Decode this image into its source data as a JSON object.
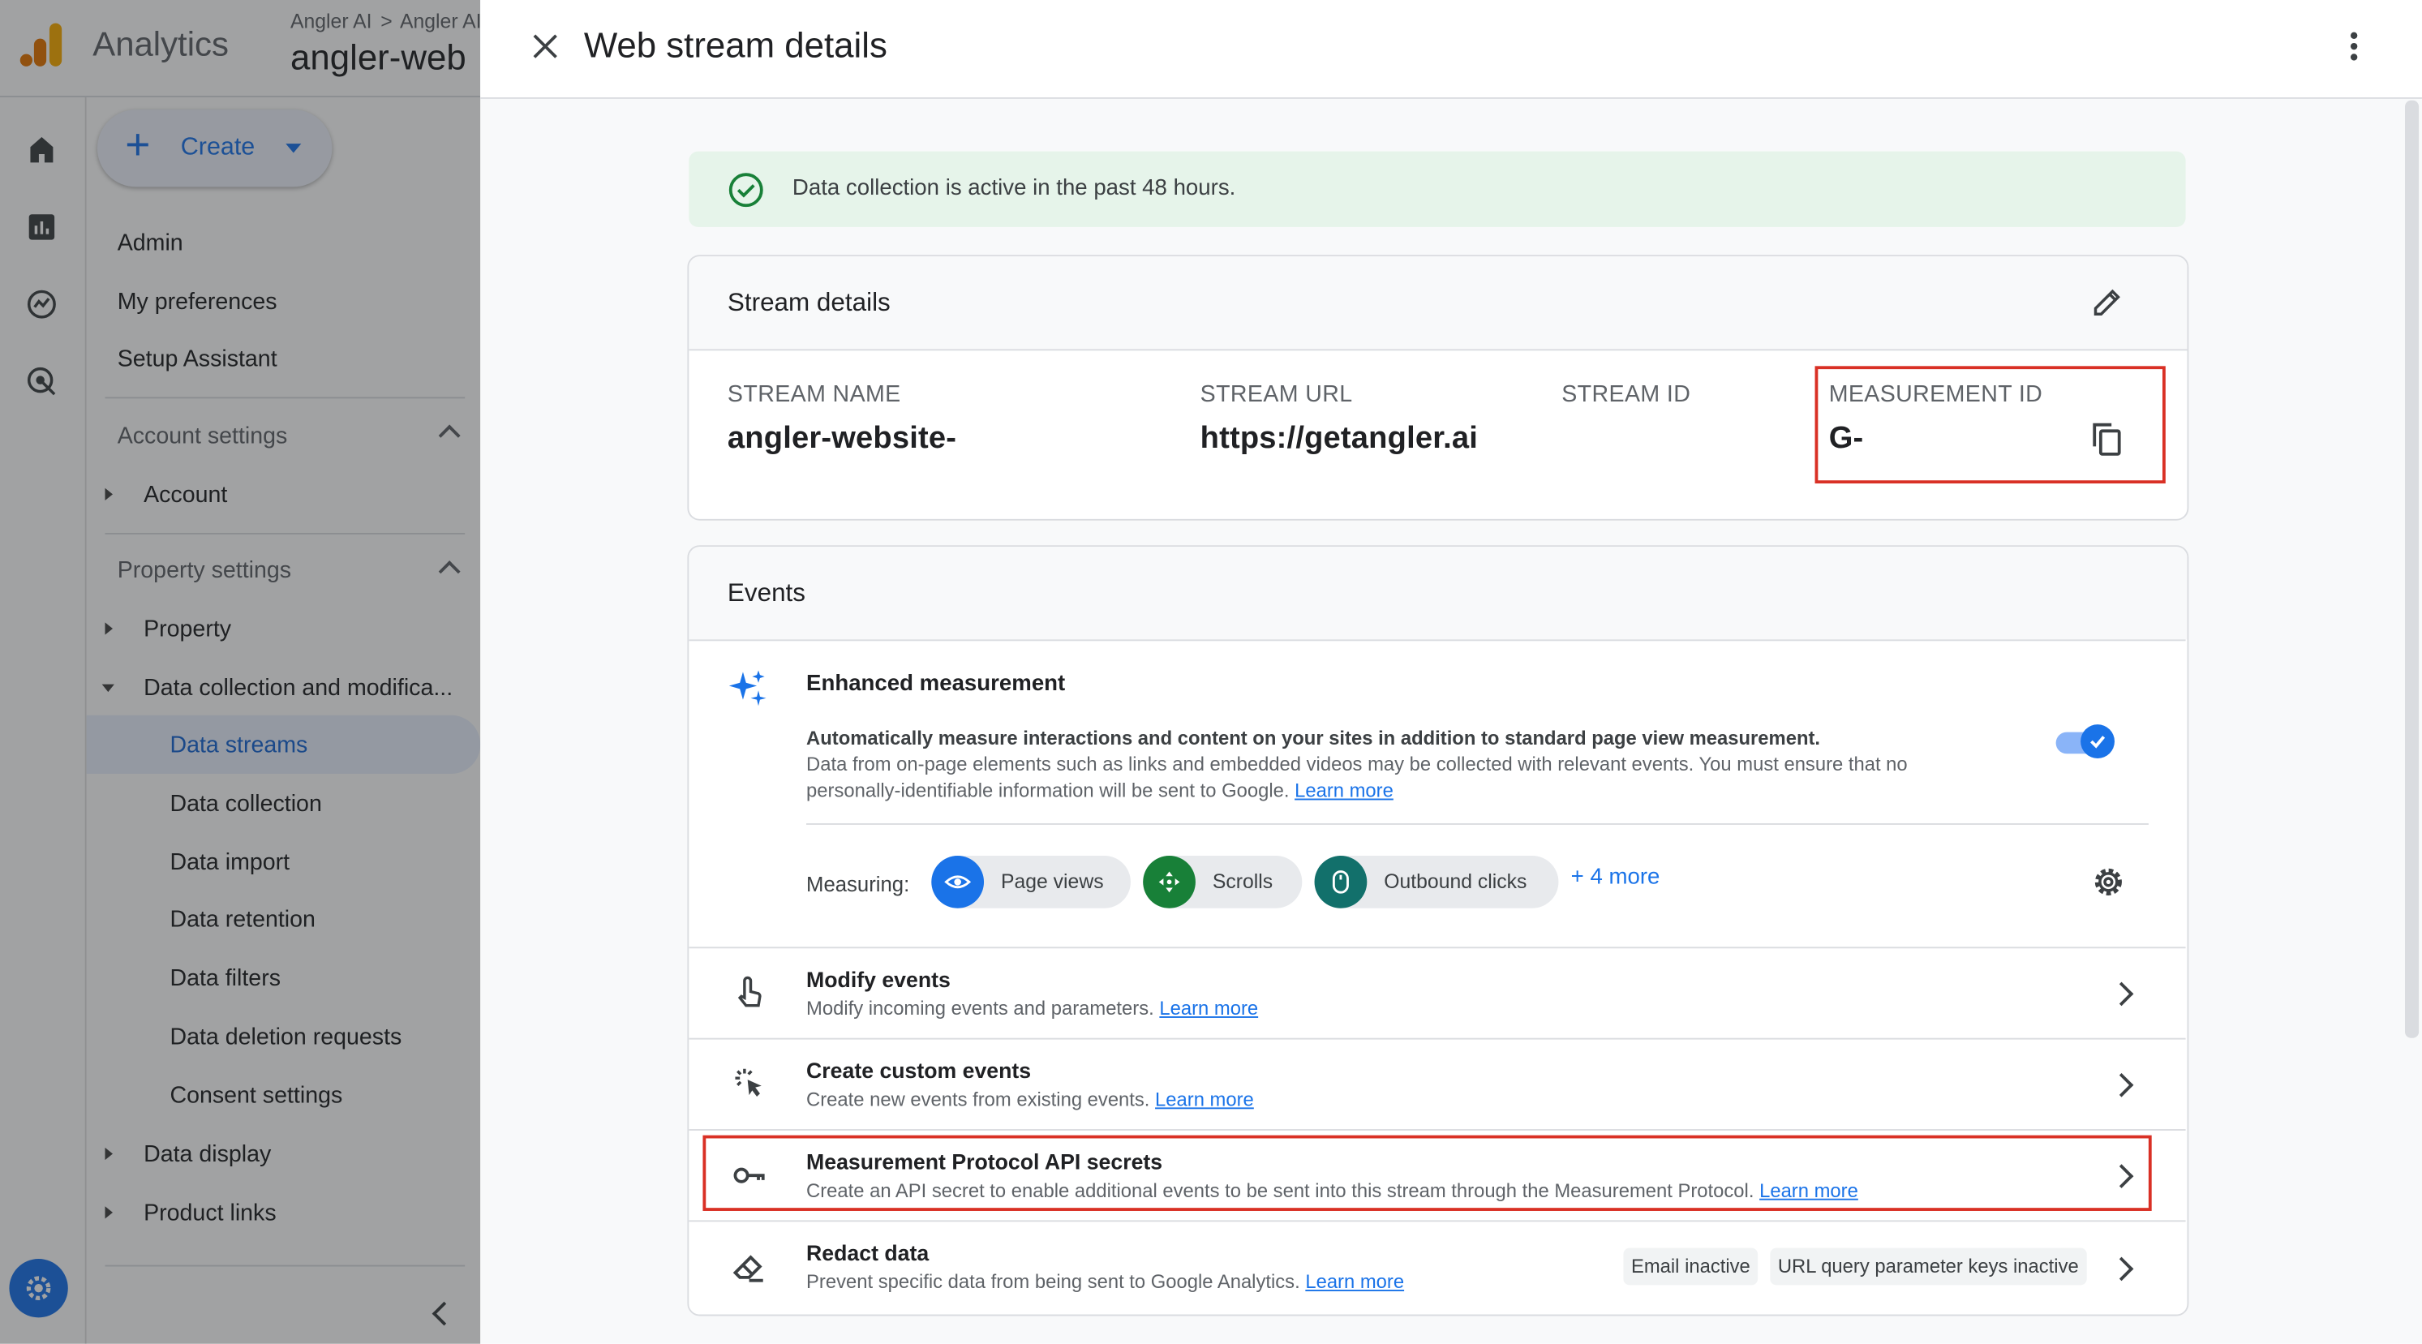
{
  "header": {
    "app_name": "Analytics",
    "breadcrumb_1": "Angler AI",
    "breadcrumb_2": "Angler AI",
    "property_name": "angler-web"
  },
  "sidebar": {
    "create_label": "Create",
    "admin": "Admin",
    "my_preferences": "My preferences",
    "setup_assistant": "Setup Assistant",
    "account_settings": "Account settings",
    "account": "Account",
    "property_settings": "Property settings",
    "property": "Property",
    "data_collection_group": "Data collection and modifica...",
    "data_streams": "Data streams",
    "data_collection": "Data collection",
    "data_import": "Data import",
    "data_retention": "Data retention",
    "data_filters": "Data filters",
    "data_deletion_requests": "Data deletion requests",
    "consent_settings": "Consent settings",
    "data_display": "Data display",
    "product_links": "Product links"
  },
  "panel": {
    "title": "Web stream details",
    "status_banner": "Data collection is active in the past 48 hours."
  },
  "stream_details": {
    "heading": "Stream details",
    "stream_name_label": "STREAM NAME",
    "stream_name_value": "angler-website-",
    "stream_url_label": "STREAM URL",
    "stream_url_value": "https://getangler.ai",
    "stream_id_label": "STREAM ID",
    "measurement_id_label": "MEASUREMENT ID",
    "measurement_id_value": "G-"
  },
  "events": {
    "heading": "Events",
    "enhanced_title": "Enhanced measurement",
    "enhanced_desc_bold": "Automatically measure interactions and content on your sites in addition to standard page view measurement.",
    "enhanced_desc_1": "Data from on-page elements such as links and embedded videos may be collected with relevant events. You must ensure that no",
    "enhanced_desc_2": "personally-identifiable information will be sent to Google.",
    "learn_more": "Learn more",
    "enhanced_enabled": true,
    "measuring_label": "Measuring:",
    "chips": [
      "Page views",
      "Scrolls",
      "Outbound clicks"
    ],
    "more": "+ 4 more",
    "rows": {
      "modify_title": "Modify events",
      "modify_desc": "Modify incoming events and parameters.",
      "custom_title": "Create custom events",
      "custom_desc": "Create new events from existing events.",
      "mp_title": "Measurement Protocol API secrets",
      "mp_desc": "Create an API secret to enable additional events to be sent into this stream through the Measurement Protocol.",
      "redact_title": "Redact data",
      "redact_desc": "Prevent specific data from being sent to Google Analytics.",
      "badge_email": "Email inactive",
      "badge_url": "URL query parameter keys inactive"
    }
  },
  "colors": {
    "accent": "#1a73e8",
    "success": "#188038",
    "highlight": "#d93025",
    "analytics_orange": "#f9ab00",
    "analytics_dark_orange": "#e37400"
  }
}
